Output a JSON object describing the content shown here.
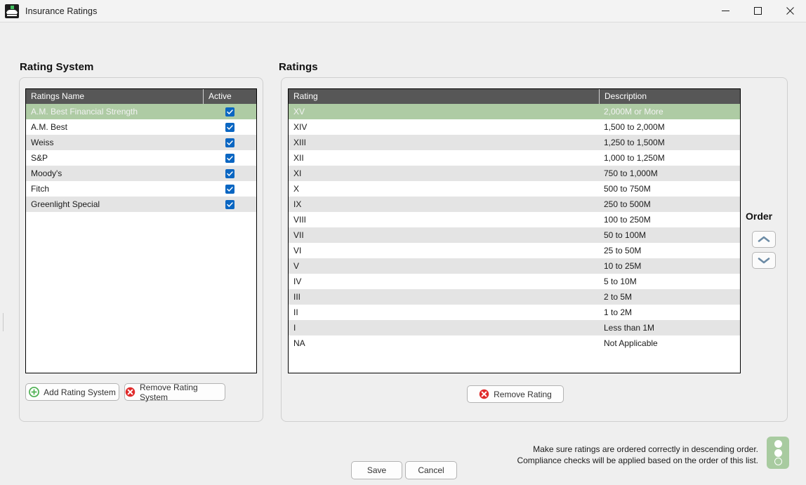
{
  "window": {
    "title": "Insurance Ratings",
    "icon": "app-logo-icon",
    "controls": {
      "minimize": "minimize-icon",
      "maximize": "maximize-icon",
      "close": "close-icon"
    }
  },
  "left_panel": {
    "title": "Rating System",
    "grid": {
      "columns": [
        "Ratings Name",
        "Active"
      ],
      "rows": [
        {
          "name": "A.M. Best Financial Strength",
          "active": true,
          "selected": true
        },
        {
          "name": "A.M. Best",
          "active": true,
          "selected": false
        },
        {
          "name": "Weiss",
          "active": true,
          "selected": false
        },
        {
          "name": "S&P",
          "active": true,
          "selected": false
        },
        {
          "name": "Moody's",
          "active": true,
          "selected": false
        },
        {
          "name": "Fitch",
          "active": true,
          "selected": false
        },
        {
          "name": "Greenlight Special",
          "active": true,
          "selected": false
        }
      ]
    },
    "buttons": {
      "add": "Add Rating System",
      "remove": "Remove Rating System"
    }
  },
  "right_panel": {
    "title": "Ratings",
    "grid": {
      "columns": [
        "Rating",
        "Description"
      ],
      "rows": [
        {
          "rating": "XV",
          "description": "2,000M or More",
          "selected": true
        },
        {
          "rating": "XIV",
          "description": "1,500 to 2,000M",
          "selected": false
        },
        {
          "rating": "XIII",
          "description": "1,250 to 1,500M",
          "selected": false
        },
        {
          "rating": "XII",
          "description": "1,000 to 1,250M",
          "selected": false
        },
        {
          "rating": "XI",
          "description": "750 to 1,000M",
          "selected": false
        },
        {
          "rating": "X",
          "description": "500 to 750M",
          "selected": false
        },
        {
          "rating": "IX",
          "description": "250 to 500M",
          "selected": false
        },
        {
          "rating": "VIII",
          "description": "100 to 250M",
          "selected": false
        },
        {
          "rating": "VII",
          "description": "50 to 100M",
          "selected": false
        },
        {
          "rating": "VI",
          "description": "25 to 50M",
          "selected": false
        },
        {
          "rating": "V",
          "description": "10 to 25M",
          "selected": false
        },
        {
          "rating": "IV",
          "description": "5 to 10M",
          "selected": false
        },
        {
          "rating": "III",
          "description": "2 to 5M",
          "selected": false
        },
        {
          "rating": "II",
          "description": "1 to 2M",
          "selected": false
        },
        {
          "rating": "I",
          "description": "Less than 1M",
          "selected": false
        },
        {
          "rating": "NA",
          "description": "Not Applicable",
          "selected": false
        }
      ]
    },
    "buttons": {
      "remove": "Remove Rating"
    }
  },
  "order": {
    "label": "Order",
    "up_icon": "chevron-up-icon",
    "down_icon": "chevron-down-icon"
  },
  "footer": {
    "note_line1": "Make sure ratings are ordered correctly in descending order.",
    "note_line2": "Compliance checks will be applied based on the order of this list.",
    "save": "Save",
    "cancel": "Cancel",
    "widget": "traffic-light-indicator"
  },
  "colors": {
    "selection_green": "#aecba4",
    "header_gray": "#575757",
    "checkbox_blue": "#0a66c2",
    "add_icon_green": "#4caf50",
    "remove_icon_red": "#e02b2b",
    "widget_green": "#a8cba0",
    "window_background": "#efefef"
  }
}
